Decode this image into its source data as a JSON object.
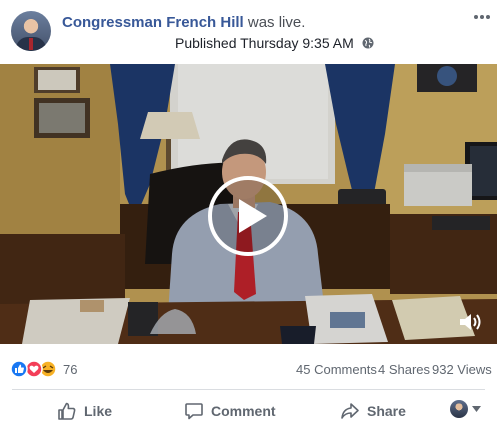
{
  "header": {
    "page_name": "Congressman French Hill",
    "status": " was live.",
    "published": "Published Thursday 9:35 AM",
    "privacy_icon": "globe-icon",
    "more_icon": "more-options-icon"
  },
  "video": {
    "play_icon": "play-icon",
    "volume_icon": "volume-icon"
  },
  "stats": {
    "reaction_icons": [
      "like-reaction-icon",
      "love-reaction-icon",
      "haha-reaction-icon"
    ],
    "reactions": "76",
    "comments": "45 Comments",
    "shares": "4 Shares",
    "views": "932 Views"
  },
  "actions": {
    "like": "Like",
    "comment": "Comment",
    "share": "Share"
  },
  "colors": {
    "link_blue": "#385898",
    "muted_text": "#606770",
    "like_blue": "#1877f2",
    "love_red": "#f33e58",
    "haha_yellow": "#f7b125"
  }
}
